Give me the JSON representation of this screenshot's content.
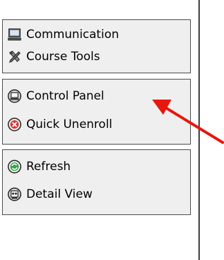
{
  "menu": {
    "groups": [
      {
        "items": [
          {
            "label": "Communication",
            "icon": "monitor-icon"
          },
          {
            "label": "Course Tools",
            "icon": "tools-icon"
          }
        ]
      },
      {
        "items": [
          {
            "label": "Control Panel",
            "icon": "control-panel-icon"
          },
          {
            "label": "Quick Unenroll",
            "icon": "unenroll-icon"
          }
        ]
      },
      {
        "items": [
          {
            "label": "Refresh",
            "icon": "refresh-icon"
          },
          {
            "label": "Detail View",
            "icon": "detail-view-icon"
          }
        ]
      }
    ]
  },
  "annotation": {
    "icon": "red-arrow-pointer",
    "color": "#e8160c"
  },
  "colors": {
    "panel_bg": "#efefef",
    "panel_border": "#4a4a4a",
    "arrow": "#e8160c"
  }
}
